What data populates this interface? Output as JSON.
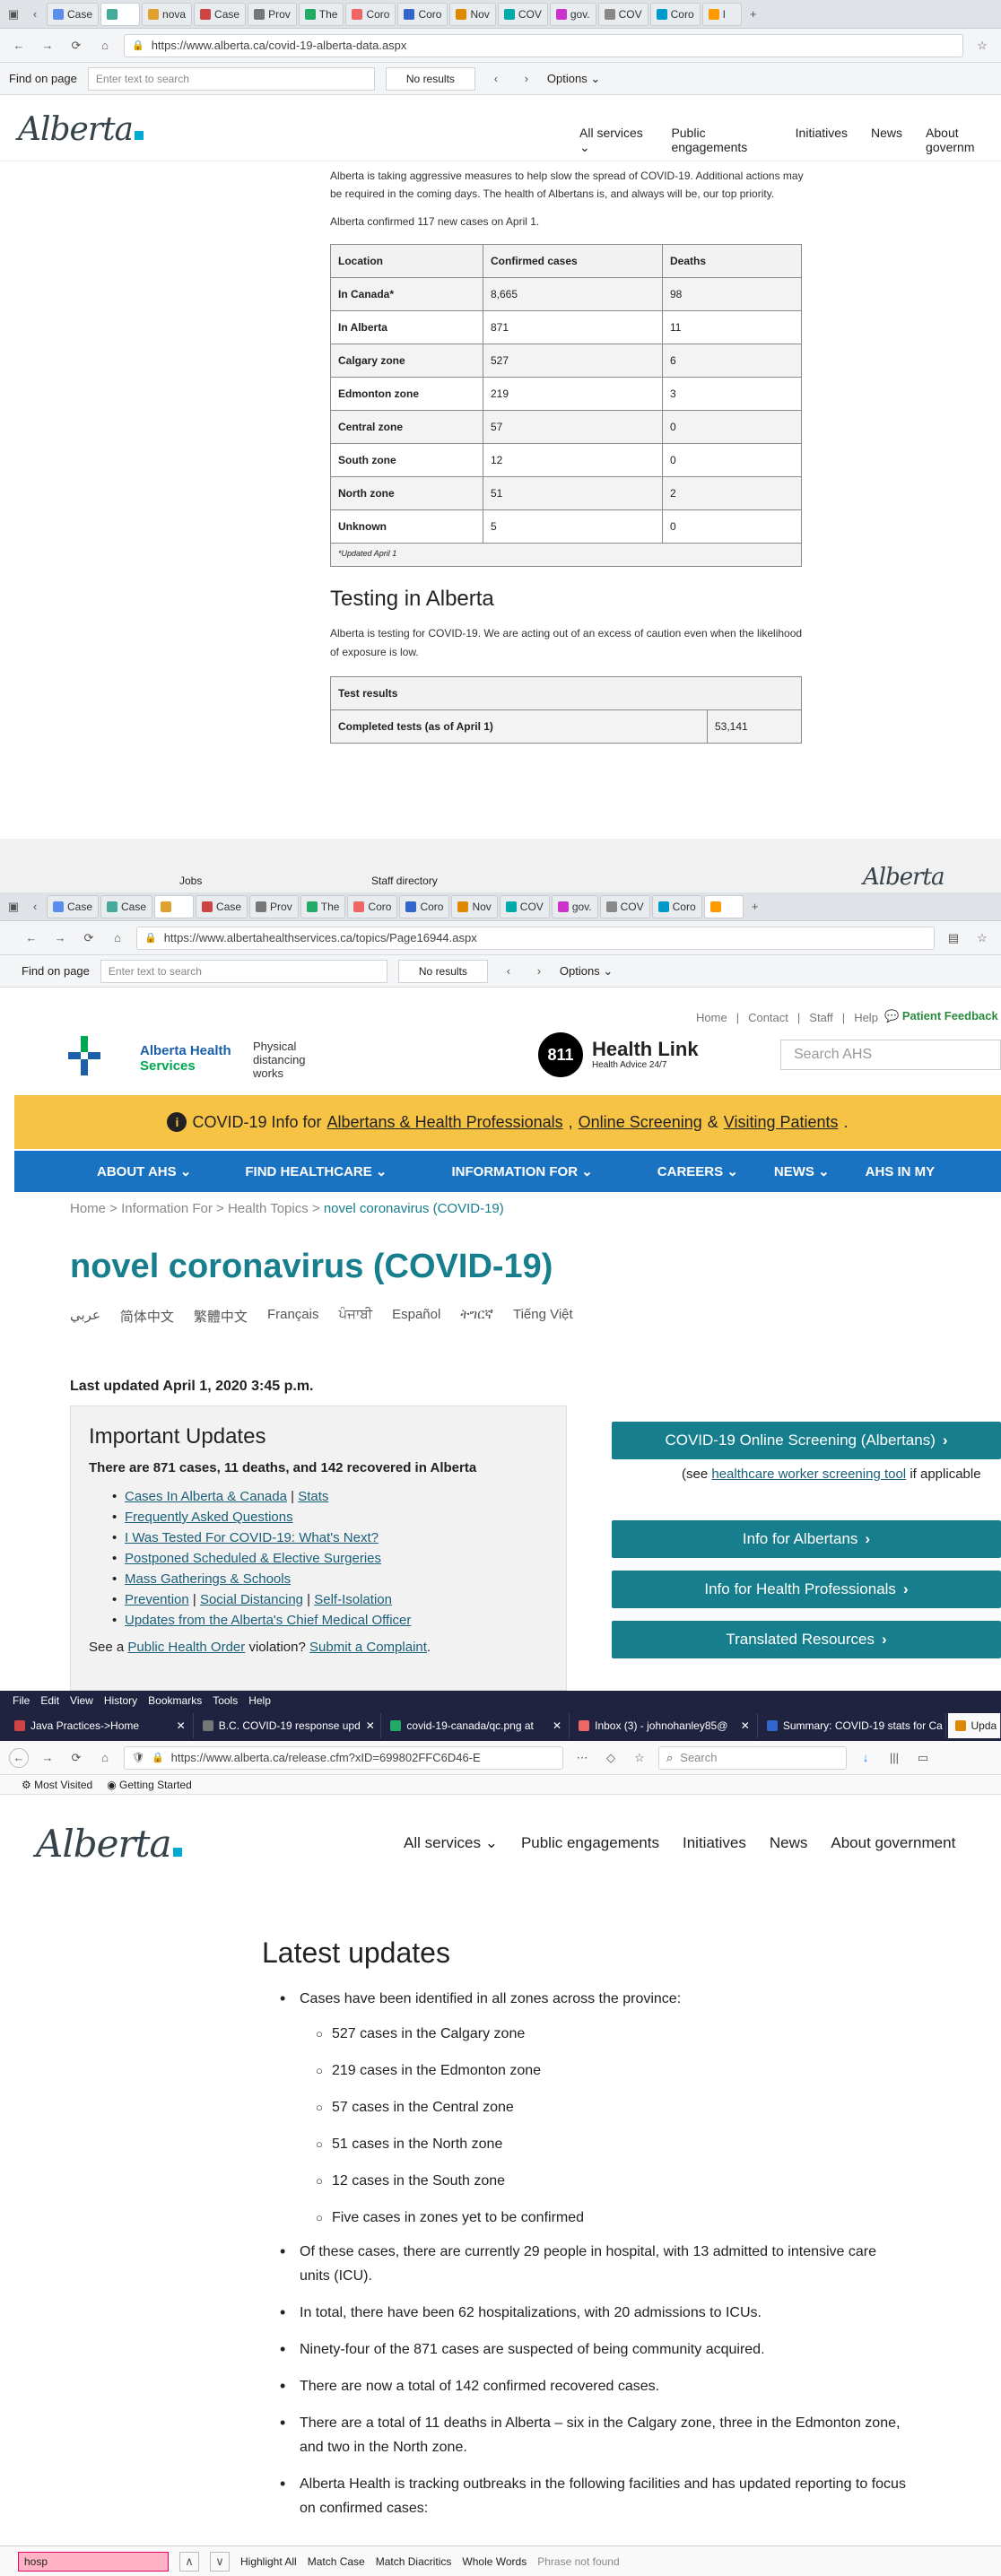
{
  "pane1": {
    "tabs": [
      "Case",
      "",
      "nova",
      "Case",
      "Prov",
      "The",
      "Coro",
      "Coro",
      "Nov",
      "COV",
      "gov.",
      "COV",
      "Coro",
      "I"
    ],
    "url": "https://www.alberta.ca/covid-19-alberta-data.aspx",
    "find": {
      "label": "Find on page",
      "placeholder": "Enter text to search",
      "status": "No results",
      "options": "Options"
    },
    "header": {
      "logo": "Alberta",
      "nav": [
        "All services",
        "Public engagements",
        "Initiatives",
        "News",
        "About governm"
      ]
    },
    "intro": "Alberta is taking aggressive measures to help slow the spread of COVID-19. Additional actions may be required in the coming days. The health of Albertans is, and always will be, our top priority.",
    "confirmed_note": "Alberta confirmed 117 new cases on April 1.",
    "table": {
      "headers": [
        "Location",
        "Confirmed cases",
        "Deaths"
      ],
      "rows": [
        [
          "In Canada*",
          "8,665",
          "98"
        ],
        [
          "In Alberta",
          "871",
          "11"
        ],
        [
          "Calgary zone",
          "527",
          "6"
        ],
        [
          "Edmonton zone",
          "219",
          "3"
        ],
        [
          "Central zone",
          "57",
          "0"
        ],
        [
          "South zone",
          "12",
          "0"
        ],
        [
          "North zone",
          "51",
          "2"
        ],
        [
          "Unknown",
          "5",
          "0"
        ]
      ],
      "footnote": "*Updated April 1"
    },
    "testing": {
      "heading": "Testing in Alberta",
      "text": "Alberta is testing for COVID-19. We are acting out of an excess of caution even when the likelihood of exposure is low.",
      "table_header": "Test results",
      "row_label": "Completed tests (as of April 1)",
      "row_value": "53,141"
    },
    "footer": {
      "jobs": "Jobs",
      "staff": "Staff directory",
      "logo": "Alberta"
    }
  },
  "pane2": {
    "tabs": [
      "Case",
      "Case",
      "",
      "Case",
      "Prov",
      "The",
      "Coro",
      "Coro",
      "Nov",
      "COV",
      "gov.",
      "COV",
      "Coro",
      ""
    ],
    "url": "https://www.albertahealthservices.ca/topics/Page16944.aspx",
    "find": {
      "label": "Find on page",
      "placeholder": "Enter text to search",
      "status": "No results",
      "options": "Options"
    },
    "toplinks": [
      "Home",
      "Contact",
      "Staff",
      "Help"
    ],
    "feedback": "Patient Feedback",
    "logo_line1": "Alberta Health",
    "logo_line2": "Services",
    "tagline": "Physical distancing works",
    "healthlink_num": "811",
    "healthlink_title": "Health Link",
    "healthlink_sub": "Health Advice 24/7",
    "search_placeholder": "Search AHS",
    "banner": {
      "prefix": "COVID-19 Info for",
      "l1": "Albertans & Health Professionals",
      "sep1": ",",
      "l2": "Online Screening",
      "sep2": "&",
      "l3": "Visiting Patients",
      "end": "."
    },
    "nav": [
      "ABOUT AHS",
      "FIND HEALTHCARE",
      "INFORMATION FOR",
      "CAREERS",
      "NEWS",
      "AHS IN MY"
    ],
    "breadcrumb": [
      "Home",
      "Information For",
      "Health Topics",
      "novel coronavirus (COVID-19)"
    ],
    "title": "novel coronavirus (COVID-19)",
    "languages": [
      "عربي",
      "简体中文",
      "繁體中文",
      "Français",
      "ਪੰਜਾਬੀ",
      "Español",
      "ትግርኛ",
      "Tiếng Việt"
    ],
    "last_updated": "Last updated April 1, 2020 3:45 p.m.",
    "updates": {
      "heading": "Important Updates",
      "summary": "There are 871 cases, 11 deaths, and 142 recovered in Alberta",
      "links": [
        {
          "a": "Cases In Alberta & Canada",
          "b": "Stats"
        },
        {
          "a": "Frequently Asked Questions"
        },
        {
          "a": "I Was Tested For COVID-19: What's Next?"
        },
        {
          "a": "Postponed Scheduled & Elective Surgeries"
        },
        {
          "a": "Mass Gatherings & Schools"
        },
        {
          "a": "Prevention",
          "b": "Social Distancing",
          "c": "Self-Isolation"
        },
        {
          "a": "Updates from the Alberta's Chief Medical Officer"
        }
      ],
      "order_prefix": "See a",
      "order_link": "Public Health Order",
      "order_mid": "violation?",
      "order_link2": "Submit a Complaint",
      "order_end": "."
    },
    "buttons": {
      "screening": "COVID-19 Online Screening (Albertans)",
      "see_prefix": "(see",
      "see_link": "healthcare worker screening tool",
      "see_suffix": "if applicable",
      "albertans": "Info for Albertans",
      "professionals": "Info for Health Professionals",
      "translated": "Translated Resources"
    }
  },
  "pane3": {
    "menu": [
      "File",
      "Edit",
      "View",
      "History",
      "Bookmarks",
      "Tools",
      "Help"
    ],
    "tabs": [
      "Java Practices->Home",
      "B.C. COVID-19 response upd",
      "covid-19-canada/qc.png at",
      "Inbox (3) - johnohanley85@",
      "Summary: COVID-19 stats for Ca",
      "Upda"
    ],
    "url": "https://www.alberta.ca/release.cfm?xID=699802FFC6D46-E",
    "search_placeholder": "Search",
    "bookmarks": [
      "Most Visited",
      "Getting Started"
    ],
    "header": {
      "logo": "Alberta",
      "nav": [
        "All services",
        "Public engagements",
        "Initiatives",
        "News",
        "About government"
      ]
    },
    "heading": "Latest updates",
    "intro_bullet": "Cases have been identified in all zones across the province:",
    "zones": [
      "527 cases in the Calgary zone",
      "219 cases in the Edmonton zone",
      "57 cases in the Central zone",
      "51 cases in the North zone",
      "12 cases in the South zone",
      "Five cases in zones yet to be confirmed"
    ],
    "bullets": [
      "Of these cases, there are currently 29 people in hospital, with 13 admitted to intensive care units (ICU).",
      "In total, there have been 62 hospitalizations, with 20 admissions to ICUs.",
      "Ninety-four of the 871 cases are suspected of being community acquired.",
      "There are now a total of 142 confirmed recovered cases.",
      "There are a total of 11 deaths in Alberta – six in the Calgary zone, three in the Edmonton zone, and two in the North zone.",
      "Alberta Health is tracking outbreaks in the following facilities and has updated reporting to focus on confirmed cases:"
    ],
    "findbar": {
      "value": "hosp",
      "highlight": "Highlight All",
      "matchcase": "Match Case",
      "diacritics": "Match Diacritics",
      "wholewords": "Whole Words",
      "status": "Phrase not found"
    }
  }
}
